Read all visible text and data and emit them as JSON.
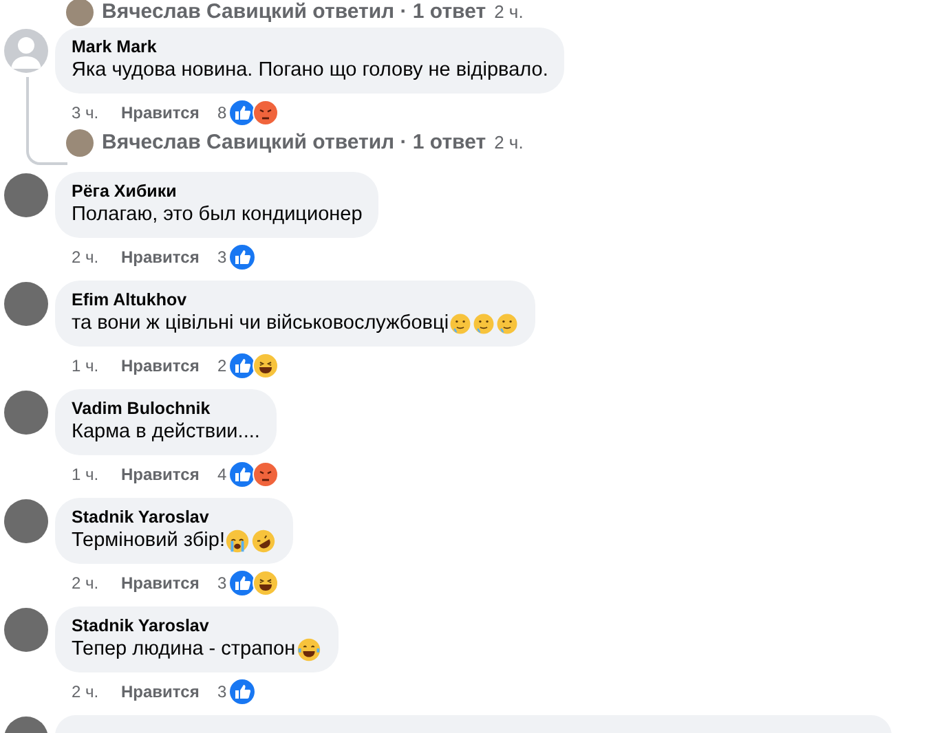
{
  "top_reply": {
    "author": "Вячеслав Савицкий ответил · 1 ответ",
    "time": "2 ч."
  },
  "comments": [
    {
      "author": "Mark Mark",
      "avatar": {
        "kind": "default"
      },
      "text": "Яка чудова новина. Погано що голову не відірвало.",
      "time": "3 ч.",
      "like": "Нравится",
      "count": "8",
      "reactions": [
        {
          "kind": "like"
        },
        {
          "kind": "angry"
        }
      ],
      "reply": {
        "author": "Вячеслав Савицкий ответил · 1 ответ",
        "time": "2 ч."
      }
    },
    {
      "author": "Рёга Хибики",
      "avatar": {
        "kind": "photo"
      },
      "text": "Полагаю, это был кондиционер",
      "time": "2 ч.",
      "like": "Нравится",
      "count": "3",
      "reactions": [
        {
          "kind": "like"
        }
      ]
    },
    {
      "author": "Efim Altukhov",
      "avatar": {
        "kind": "photo"
      },
      "text": "та вони ж цівільні чи військовослужбовці ",
      "emojis": [
        {
          "kind": "tear"
        },
        {
          "kind": "tear"
        },
        {
          "kind": "tear"
        }
      ],
      "time": "1 ч.",
      "like": "Нравится",
      "count": "2",
      "reactions": [
        {
          "kind": "like"
        },
        {
          "kind": "haha"
        }
      ]
    },
    {
      "author": "Vadim Bulochnik",
      "avatar": {
        "kind": "photo"
      },
      "text": "Карма в действии....",
      "time": "1 ч.",
      "like": "Нравится",
      "count": "4",
      "reactions": [
        {
          "kind": "like"
        },
        {
          "kind": "angry"
        }
      ]
    },
    {
      "author": "Stadnik Yaroslav",
      "avatar": {
        "kind": "photo"
      },
      "text": "Терміновий збір!",
      "emojis": [
        {
          "kind": "crying"
        },
        {
          "kind": "rofl"
        }
      ],
      "time": "2 ч.",
      "like": "Нравится",
      "count": "3",
      "reactions": [
        {
          "kind": "like"
        },
        {
          "kind": "haha"
        }
      ]
    },
    {
      "author": "Stadnik Yaroslav",
      "avatar": {
        "kind": "photo"
      },
      "text": "Тепер людина - страпон",
      "emojis": [
        {
          "kind": "joy"
        }
      ],
      "time": "2 ч.",
      "like": "Нравится",
      "count": "3",
      "reactions": [
        {
          "kind": "like"
        }
      ]
    }
  ]
}
